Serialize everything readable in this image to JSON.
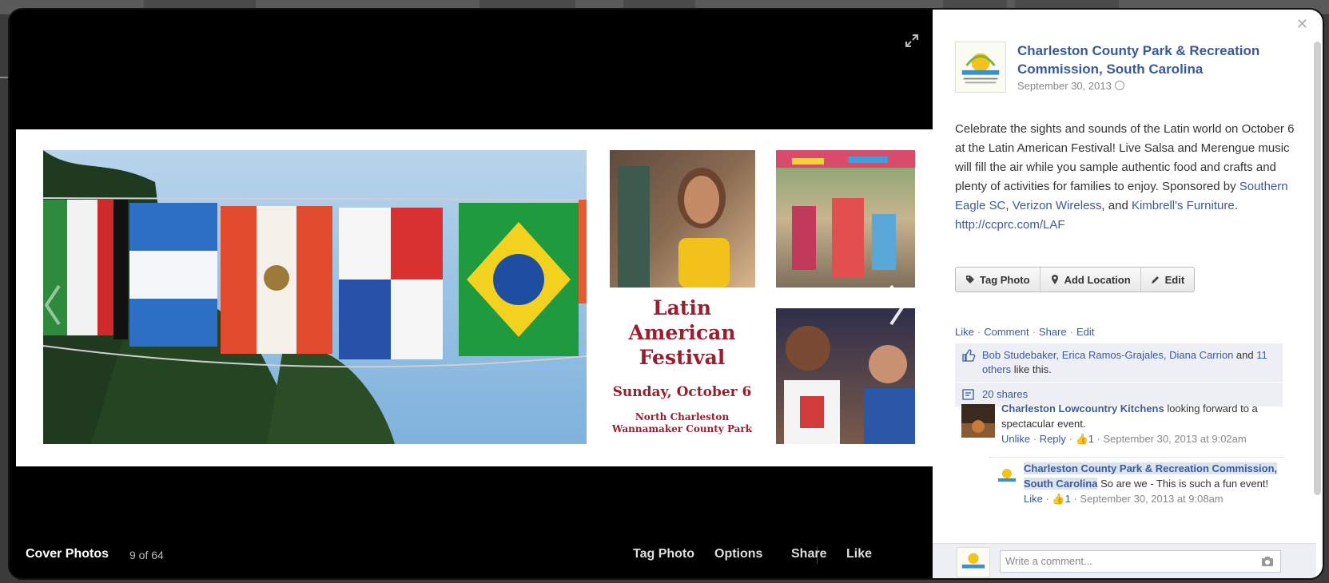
{
  "viewer": {
    "album": "Cover Photos",
    "position": "9 of 64",
    "footer_actions": [
      "Tag Photo",
      "Options",
      "Share",
      "Like"
    ]
  },
  "photo": {
    "festival_title": [
      "Latin",
      "American",
      "Festival"
    ],
    "festival_date": "Sunday, October 6",
    "festival_place": [
      "North Charleston",
      "Wannamaker County Park"
    ]
  },
  "post": {
    "page_name": "Charleston County Park & Recreation Commission, South Carolina",
    "date": "September 30, 2013",
    "text_before": "Celebrate the sights and sounds of the Latin world on October 6 at the Latin American Festival! Live Salsa and Merengue music will fill the air while you sample authentic food and crafts and plenty of activities for families to enjoy. Sponsored by ",
    "sponsor1": "Southern Eagle SC",
    "sponsor2": "Verizon Wireless",
    "and_text": ", and ",
    "sponsor3": "Kimbrell's Furniture",
    "period": ".",
    "url": "http://ccprc.com/LAF"
  },
  "actions": {
    "tag_photo": "Tag Photo",
    "add_location": "Add Location",
    "edit": "Edit"
  },
  "links": {
    "like": "Like",
    "comment": "Comment",
    "share": "Share",
    "edit": "Edit",
    "dot": "·"
  },
  "likes": {
    "names": "Bob Studebaker, Erica Ramos-Grajales, Diana Carrion",
    "and": " and ",
    "others": "11 others",
    "suffix": " like this.",
    "shares": "20 shares"
  },
  "comments": [
    {
      "author": "Charleston Lowcountry Kitchens",
      "text": " looking forward to a spectacular event.",
      "action": "Unlike",
      "reply": "Reply",
      "likes": "1",
      "time": "September 30, 2013 at 9:02am"
    },
    {
      "author": "Charleston County Park & Recreation Commission, South Carolina",
      "text": " So are we - This is such a fun event!",
      "action": "Like",
      "likes": "1",
      "time": "September 30, 2013 at 9:08am"
    }
  ],
  "composer": {
    "placeholder": "Write a comment..."
  },
  "icons": {
    "close": "close-icon",
    "expand": "expand-icon",
    "globe": "globe-icon",
    "camera": "camera-icon"
  },
  "colors": {
    "link": "#3b5998",
    "festival_red": "#9a1e2e",
    "panel_bg": "#edeff4"
  }
}
